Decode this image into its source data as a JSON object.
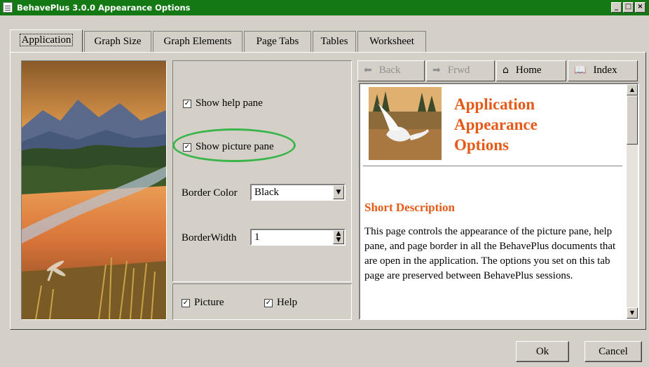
{
  "window": {
    "title": "BehavePlus 3.0.0 Appearance Options",
    "minimize": "_",
    "maximize": "□",
    "close": "×"
  },
  "tabs": [
    {
      "label": "Application",
      "active": true
    },
    {
      "label": "Graph Size"
    },
    {
      "label": "Graph Elements"
    },
    {
      "label": "Page Tabs"
    },
    {
      "label": "Tables"
    },
    {
      "label": "Worksheet"
    }
  ],
  "options": {
    "show_help_pane": {
      "label": "Show help pane",
      "checked": true
    },
    "show_picture_pane": {
      "label": "Show picture pane",
      "checked": true
    },
    "border_color": {
      "label": "Border Color",
      "value": "Black"
    },
    "border_width": {
      "label": "BorderWidth",
      "value": "1"
    },
    "picture": {
      "label": "Picture",
      "checked": true
    },
    "help": {
      "label": "Help",
      "checked": true
    }
  },
  "help_toolbar": {
    "back": "Back",
    "forward": "Frwd",
    "home": "Home",
    "index": "Index"
  },
  "help": {
    "title_line1": "Application",
    "title_line2": "Appearance",
    "title_line3": "Options",
    "section_heading": "Short Description",
    "body": "This page controls the appearance of the picture pane, help pane, and page border in all the BehavePlus documents that are open in the application. The options you set on this tab page are preserved between BehavePlus sessions.",
    "accent_color": "#e55a16"
  },
  "buttons": {
    "ok": "Ok",
    "cancel": "Cancel"
  },
  "colors": {
    "titlebar": "#147814",
    "highlight_ellipse": "#39b54a",
    "face": "#d4d0c8"
  }
}
